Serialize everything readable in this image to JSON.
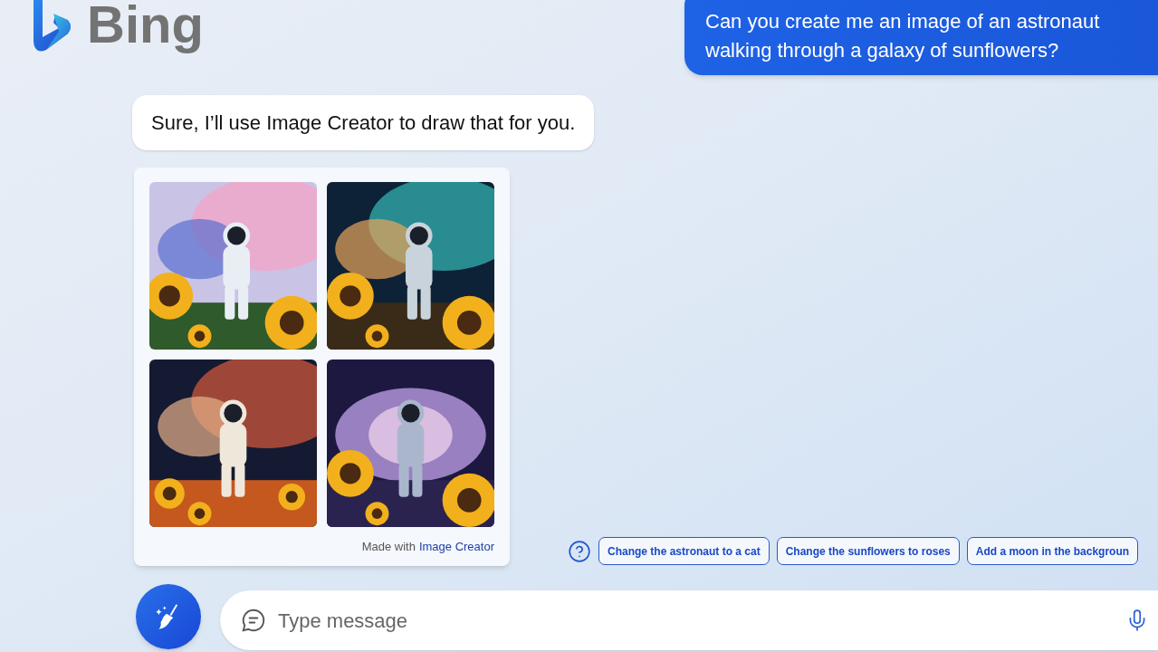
{
  "header": {
    "logo_text": "Bing"
  },
  "messages": [
    {
      "kind": "user",
      "text": "Can you create me an image of an astronaut walking through a galaxy of sunflowers?"
    },
    {
      "kind": "bot",
      "text": "Sure, I’ll use Image Creator to draw that for you."
    }
  ],
  "image_card": {
    "caption": "Made with",
    "caption_link": "Image Creator"
  },
  "suggestions": [
    {
      "text": "Change the astronaut to a cat"
    },
    {
      "text": "Change the sunflowers to roses"
    },
    {
      "text": "Add a moon in the backgroun"
    }
  ],
  "composer": {
    "placeholder": "Type message"
  }
}
